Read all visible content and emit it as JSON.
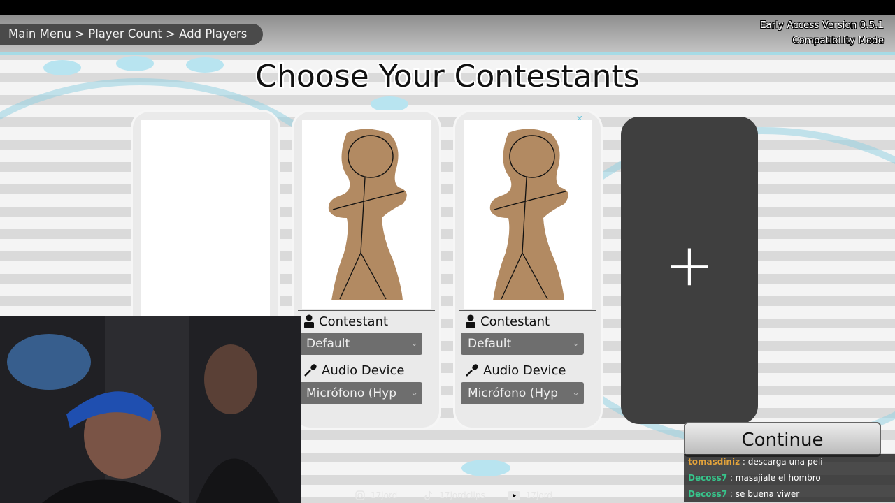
{
  "header": {
    "breadcrumb": "Main Menu > Player Count > Add Players",
    "version_line1": "Early Access Version 0.5.1",
    "version_line2": "Compatibility Mode"
  },
  "title": "Choose Your Contestants",
  "cards": [
    {
      "contestant_label": "Contestant",
      "contestant_value": "Default",
      "audio_label": "Audio Device",
      "audio_value": "Micrófono (Hyp",
      "close": "x"
    },
    {
      "contestant_label": "Contestant",
      "contestant_value": "Default",
      "audio_label": "Audio Device",
      "audio_value": "Micrófono (Hyp",
      "close": "x"
    }
  ],
  "add_button": "+",
  "continue_label": "Continue",
  "colors": {
    "accent": "#a6dbe6",
    "card_bg": "#eaeaea",
    "select_bg": "#6e6e6e",
    "add_card_bg": "#3f3f3f"
  },
  "chat": [
    {
      "user": "tomasdiniz",
      "user_color": "#e3a33b",
      "message": ": descarga una peli"
    },
    {
      "user": "Decoss7",
      "user_color": "#37c48b",
      "message": ": masajiale el hombro"
    },
    {
      "user": "Decoss7",
      "user_color": "#37c48b",
      "message": ": se buena viwer"
    }
  ],
  "social": {
    "instagram": "17jord_",
    "tiktok": "17jordclips",
    "youtube": "17jord"
  }
}
